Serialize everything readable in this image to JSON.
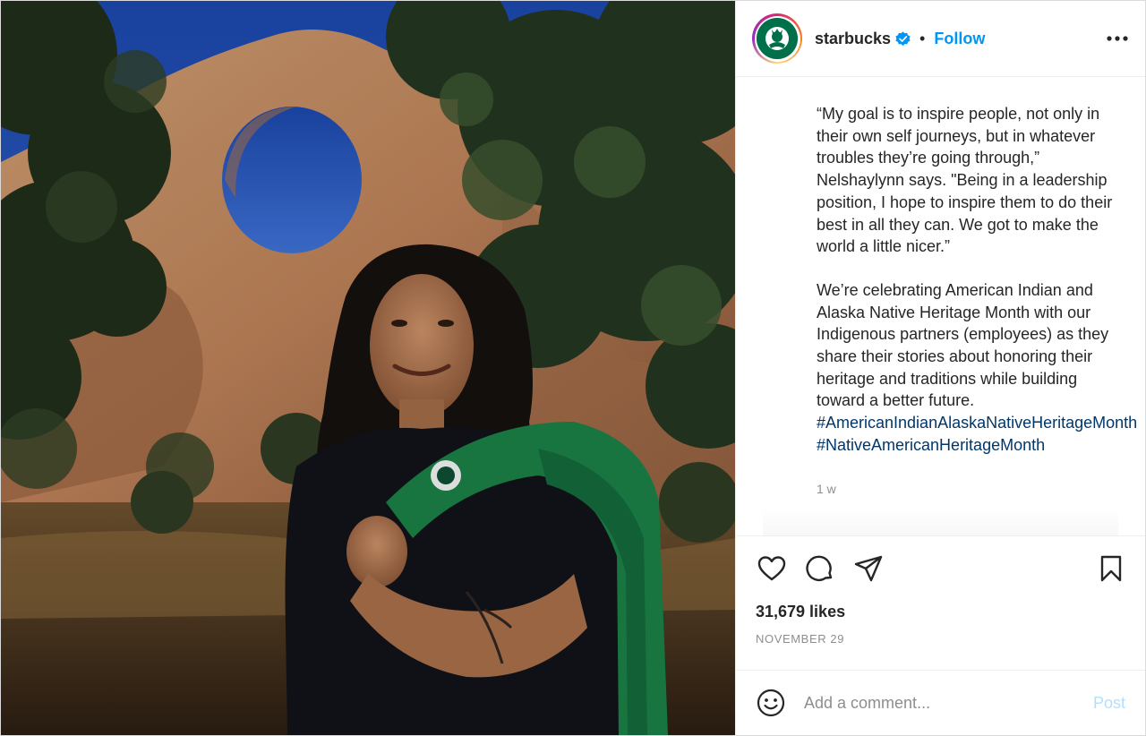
{
  "account": {
    "username": "starbucks",
    "follow_label": "Follow",
    "separator": "•"
  },
  "caption": {
    "paragraph_1": "“My goal is to inspire people, not only in their own self journeys, but in whatever troubles they’re going through,” Nelshaylynn says. \"Being in a leadership position, I hope to inspire them to do their best in all they can. We got to make the world a little nicer.”",
    "paragraph_2": "We’re celebrating American Indian and Alaska Native Heritage Month with our Indigenous partners (employees) as they share their stories about honoring their heritage and traditions while building toward a better future.",
    "hashtags": [
      "#AmericanIndianAlaskaNativeHeritageMonth",
      "#NativeAmericanHeritageMonth"
    ],
    "time_ago": "1 w"
  },
  "stats": {
    "likes": "31,679 likes",
    "date": "NOVEMBER 29"
  },
  "comment": {
    "placeholder": "Add a comment...",
    "post_label": "Post"
  },
  "icons": {
    "like": "heart-icon",
    "comment": "comment-icon",
    "share": "share-icon",
    "save": "bookmark-icon",
    "more": "more-options-icon",
    "emoji": "emoji-icon",
    "verified": "verified-badge-icon"
  },
  "colors": {
    "link": "#0095f6",
    "hashtag": "#00376b",
    "muted": "#8e8e8e",
    "brand_green": "#00704a"
  }
}
